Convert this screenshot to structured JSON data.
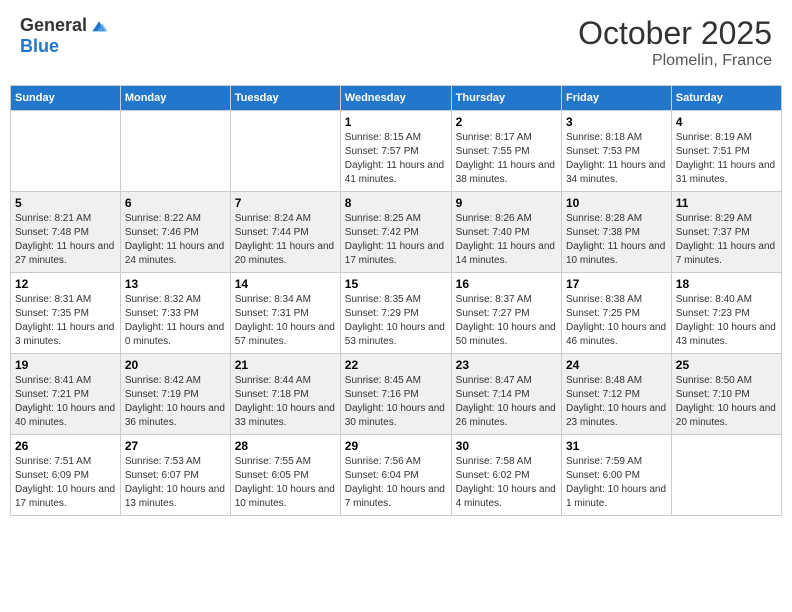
{
  "header": {
    "logo_general": "General",
    "logo_blue": "Blue",
    "month": "October 2025",
    "location": "Plomelin, France"
  },
  "days_of_week": [
    "Sunday",
    "Monday",
    "Tuesday",
    "Wednesday",
    "Thursday",
    "Friday",
    "Saturday"
  ],
  "weeks": [
    [
      {
        "day": "",
        "info": ""
      },
      {
        "day": "",
        "info": ""
      },
      {
        "day": "",
        "info": ""
      },
      {
        "day": "1",
        "info": "Sunrise: 8:15 AM\nSunset: 7:57 PM\nDaylight: 11 hours and 41 minutes."
      },
      {
        "day": "2",
        "info": "Sunrise: 8:17 AM\nSunset: 7:55 PM\nDaylight: 11 hours and 38 minutes."
      },
      {
        "day": "3",
        "info": "Sunrise: 8:18 AM\nSunset: 7:53 PM\nDaylight: 11 hours and 34 minutes."
      },
      {
        "day": "4",
        "info": "Sunrise: 8:19 AM\nSunset: 7:51 PM\nDaylight: 11 hours and 31 minutes."
      }
    ],
    [
      {
        "day": "5",
        "info": "Sunrise: 8:21 AM\nSunset: 7:48 PM\nDaylight: 11 hours and 27 minutes."
      },
      {
        "day": "6",
        "info": "Sunrise: 8:22 AM\nSunset: 7:46 PM\nDaylight: 11 hours and 24 minutes."
      },
      {
        "day": "7",
        "info": "Sunrise: 8:24 AM\nSunset: 7:44 PM\nDaylight: 11 hours and 20 minutes."
      },
      {
        "day": "8",
        "info": "Sunrise: 8:25 AM\nSunset: 7:42 PM\nDaylight: 11 hours and 17 minutes."
      },
      {
        "day": "9",
        "info": "Sunrise: 8:26 AM\nSunset: 7:40 PM\nDaylight: 11 hours and 14 minutes."
      },
      {
        "day": "10",
        "info": "Sunrise: 8:28 AM\nSunset: 7:38 PM\nDaylight: 11 hours and 10 minutes."
      },
      {
        "day": "11",
        "info": "Sunrise: 8:29 AM\nSunset: 7:37 PM\nDaylight: 11 hours and 7 minutes."
      }
    ],
    [
      {
        "day": "12",
        "info": "Sunrise: 8:31 AM\nSunset: 7:35 PM\nDaylight: 11 hours and 3 minutes."
      },
      {
        "day": "13",
        "info": "Sunrise: 8:32 AM\nSunset: 7:33 PM\nDaylight: 11 hours and 0 minutes."
      },
      {
        "day": "14",
        "info": "Sunrise: 8:34 AM\nSunset: 7:31 PM\nDaylight: 10 hours and 57 minutes."
      },
      {
        "day": "15",
        "info": "Sunrise: 8:35 AM\nSunset: 7:29 PM\nDaylight: 10 hours and 53 minutes."
      },
      {
        "day": "16",
        "info": "Sunrise: 8:37 AM\nSunset: 7:27 PM\nDaylight: 10 hours and 50 minutes."
      },
      {
        "day": "17",
        "info": "Sunrise: 8:38 AM\nSunset: 7:25 PM\nDaylight: 10 hours and 46 minutes."
      },
      {
        "day": "18",
        "info": "Sunrise: 8:40 AM\nSunset: 7:23 PM\nDaylight: 10 hours and 43 minutes."
      }
    ],
    [
      {
        "day": "19",
        "info": "Sunrise: 8:41 AM\nSunset: 7:21 PM\nDaylight: 10 hours and 40 minutes."
      },
      {
        "day": "20",
        "info": "Sunrise: 8:42 AM\nSunset: 7:19 PM\nDaylight: 10 hours and 36 minutes."
      },
      {
        "day": "21",
        "info": "Sunrise: 8:44 AM\nSunset: 7:18 PM\nDaylight: 10 hours and 33 minutes."
      },
      {
        "day": "22",
        "info": "Sunrise: 8:45 AM\nSunset: 7:16 PM\nDaylight: 10 hours and 30 minutes."
      },
      {
        "day": "23",
        "info": "Sunrise: 8:47 AM\nSunset: 7:14 PM\nDaylight: 10 hours and 26 minutes."
      },
      {
        "day": "24",
        "info": "Sunrise: 8:48 AM\nSunset: 7:12 PM\nDaylight: 10 hours and 23 minutes."
      },
      {
        "day": "25",
        "info": "Sunrise: 8:50 AM\nSunset: 7:10 PM\nDaylight: 10 hours and 20 minutes."
      }
    ],
    [
      {
        "day": "26",
        "info": "Sunrise: 7:51 AM\nSunset: 6:09 PM\nDaylight: 10 hours and 17 minutes."
      },
      {
        "day": "27",
        "info": "Sunrise: 7:53 AM\nSunset: 6:07 PM\nDaylight: 10 hours and 13 minutes."
      },
      {
        "day": "28",
        "info": "Sunrise: 7:55 AM\nSunset: 6:05 PM\nDaylight: 10 hours and 10 minutes."
      },
      {
        "day": "29",
        "info": "Sunrise: 7:56 AM\nSunset: 6:04 PM\nDaylight: 10 hours and 7 minutes."
      },
      {
        "day": "30",
        "info": "Sunrise: 7:58 AM\nSunset: 6:02 PM\nDaylight: 10 hours and 4 minutes."
      },
      {
        "day": "31",
        "info": "Sunrise: 7:59 AM\nSunset: 6:00 PM\nDaylight: 10 hours and 1 minute."
      },
      {
        "day": "",
        "info": ""
      }
    ]
  ]
}
